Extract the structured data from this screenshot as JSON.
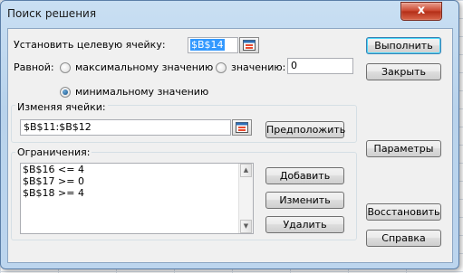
{
  "window": {
    "title": "Поиск решения",
    "close_glyph": "x"
  },
  "target": {
    "label": "Установить целевую ячейку:",
    "value": "$B$14"
  },
  "equal_to": {
    "label": "Равной:",
    "options": {
      "max": "максимальному значению",
      "value": "значению:",
      "min": "минимальному значению"
    },
    "selected": "min",
    "value_field": "0"
  },
  "changing_cells": {
    "label": "Изменяя ячейки:",
    "value": "$B$11:$B$12",
    "guess_button": "Предположить"
  },
  "constraints": {
    "label": "Ограничения:",
    "items": [
      "$B$16 <= 4",
      "$B$17 >= 0",
      "$B$18 >= 4"
    ],
    "add_button": "Добавить",
    "change_button": "Изменить",
    "delete_button": "Удалить"
  },
  "actions": {
    "solve": "Выполнить",
    "close": "Закрыть",
    "options": "Параметры",
    "reset": "Восстановить",
    "help": "Справка"
  },
  "icons": {
    "ref_picker": "range-select-icon",
    "close": "close-icon"
  }
}
